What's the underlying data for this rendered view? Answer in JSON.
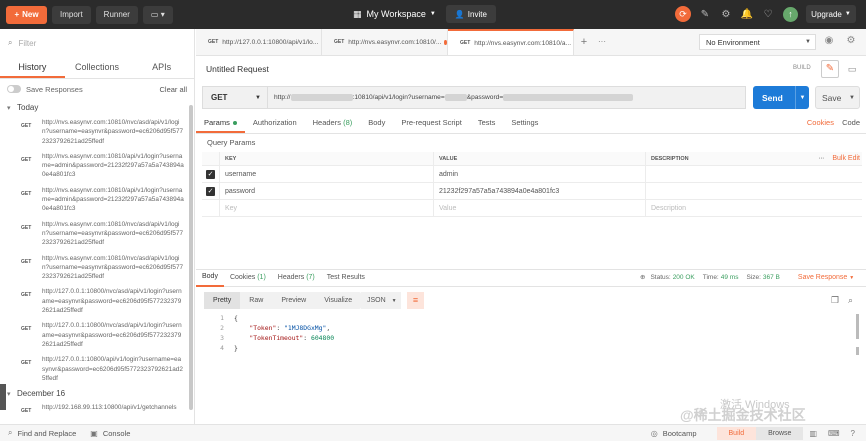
{
  "topbar": {
    "new_label": "New",
    "import_label": "Import",
    "runner_label": "Runner",
    "workspace_label": "My Workspace",
    "invite_label": "Invite",
    "upgrade_label": "Upgrade",
    "accent": "#f26b3a"
  },
  "sidebar": {
    "filter_placeholder": "Filter",
    "tabs": [
      "History",
      "Collections",
      "APIs"
    ],
    "save_responses": "Save Responses",
    "clear_all": "Clear all",
    "today_label": "Today",
    "history": [
      {
        "method": "GET",
        "url": "http://nvs.easynvr.com:10810/nvc/asd/api/v1/login?username=easynvr&password=ec6206d95f5772323792621ad25ffedf"
      },
      {
        "method": "GET",
        "url": "http://nvs.easynvr.com:10810/api/v1/login?username=admin&password=21232f297a57a5a743894a0e4a801fc3"
      },
      {
        "method": "GET",
        "url": "http://nvs.easynvr.com:10810/api/v1/login?username=admin&password=21232f297a57a5a743894a0e4a801fc3"
      },
      {
        "method": "GET",
        "url": "http://nvs.easynvr.com:10810/nvc/asd/api/v1/login?username=easynvr&password=ec6206d95f5772323792621ad25ffedf"
      },
      {
        "method": "GET",
        "url": "http://nvs.easynvr.com:10810/nvc/asd/api/v1/login?username=easynvr&password=ec6206d95f5772323792621ad25ffedf"
      },
      {
        "method": "GET",
        "url": "http://127.0.0.1:10800/nvc/asd/api/v1/login?username=easynvr&password=ec6206d95f5772323792621ad25ffedf"
      },
      {
        "method": "GET",
        "url": "http://127.0.0.1:10800/nvc/asd/api/v1/login?username=easynvr&password=ec6206d95f5772323792621ad25ffedf"
      },
      {
        "method": "GET",
        "url": "http://127.0.0.1:10800/api/v1/login?username=easynvr&password=ec6206d95f5772323792621ad25ffedf"
      }
    ],
    "december_label": "December 16",
    "december_item": {
      "method": "GET",
      "url": "http://192.168.99.113:10800/api/v1/getchannels"
    }
  },
  "tabs": [
    {
      "method": "GET",
      "label": "http://127.0.0.1:10800/api/v1/lo..."
    },
    {
      "method": "GET",
      "label": "http://nvs.easynvr.com:10810/..."
    },
    {
      "method": "GET",
      "label": "http://nvs.easynvr.com:10810/a..."
    }
  ],
  "environment": "No Environment",
  "request": {
    "title": "Untitled Request",
    "build_label": "BUILD",
    "method": "GET",
    "url_start": "http://",
    "url_mid1": ":10810/api/v1/login?username=",
    "url_mid2": "&password=",
    "send_label": "Send",
    "save_label": "Save",
    "tabs": [
      "Params",
      "Authorization",
      "Headers",
      "Body",
      "Pre-request Script",
      "Tests",
      "Settings"
    ],
    "headers_count": "(8)",
    "cookies_label": "Cookies",
    "code_label": "Code"
  },
  "query_params": {
    "title": "Query Params",
    "headers": {
      "key": "KEY",
      "value": "VALUE",
      "description": "DESCRIPTION",
      "bulk_edit": "Bulk Edit"
    },
    "rows": [
      {
        "key": "username",
        "value": "admin",
        "description": ""
      },
      {
        "key": "password",
        "value": "21232f297a57a5a743894a0e4a801fc3",
        "description": ""
      }
    ],
    "placeholder": {
      "key": "Key",
      "value": "Value",
      "description": "Description"
    }
  },
  "response": {
    "tabs": [
      "Body",
      "Cookies",
      "Headers",
      "Test Results"
    ],
    "cookies_count": "(1)",
    "headers_count": "(7)",
    "status_label": "Status:",
    "status_value": "200 OK",
    "time_label": "Time:",
    "time_value": "49 ms",
    "size_label": "Size:",
    "size_value": "367 B",
    "save_response": "Save Response",
    "formats": [
      "Pretty",
      "Raw",
      "Preview",
      "Visualize"
    ],
    "format_type": "JSON",
    "body": {
      "line1": "{",
      "token_key": "\"Token\"",
      "token_value": "\"1MJ8DGxMg\"",
      "timeout_key": "\"TokenTimeout\"",
      "timeout_value": "604800",
      "line4": "}"
    }
  },
  "footer": {
    "find_replace": "Find and Replace",
    "console": "Console",
    "bootcamp": "Bootcamp",
    "build": "Build",
    "browse": "Browse"
  },
  "watermark": {
    "line1": "激活 Windows",
    "line2": "@稀土掘金技术社区"
  }
}
